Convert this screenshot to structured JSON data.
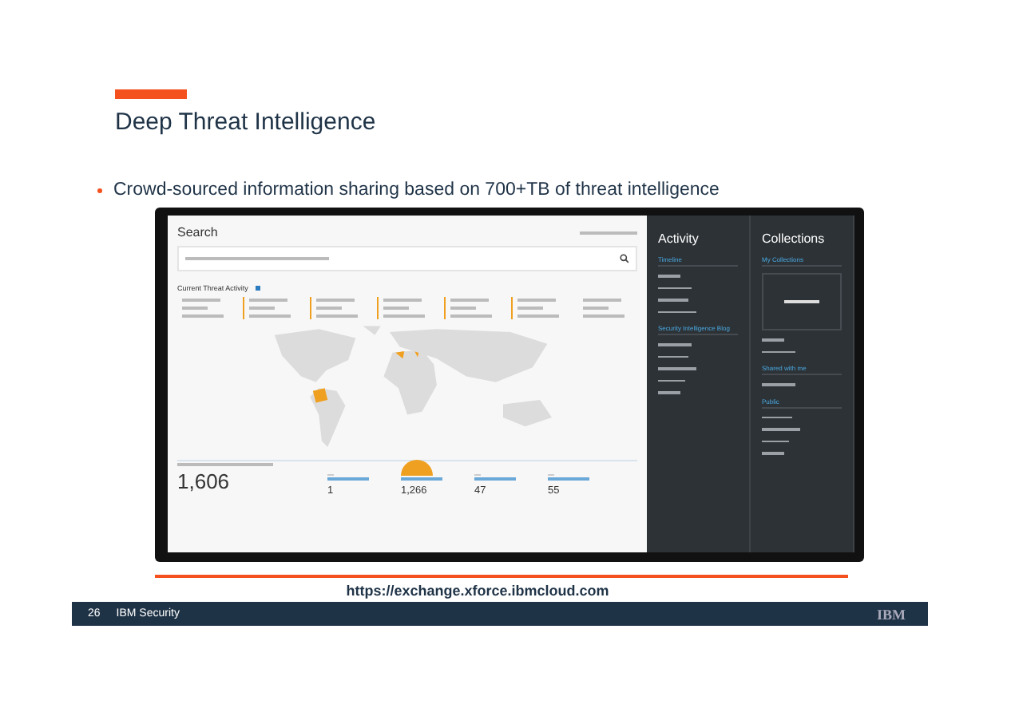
{
  "slide": {
    "title": "Deep Threat Intelligence",
    "bullet": "Crowd-sourced information sharing based on 700+TB of threat intelligence",
    "link": "https://exchange.xforce.ibmcloud.com"
  },
  "app": {
    "search_title": "Search",
    "activity_title": "Current Threat Activity",
    "total": "1,606",
    "stats": [
      {
        "value": "1",
        "bubble": false
      },
      {
        "value": "1,266",
        "bubble": true
      },
      {
        "value": "47",
        "bubble": false
      },
      {
        "value": "55",
        "bubble": false
      }
    ],
    "activity": {
      "title": "Activity",
      "sections": [
        {
          "heading": "Timeline"
        },
        {
          "heading": "Security Intelligence Blog"
        }
      ]
    },
    "collections": {
      "title": "Collections",
      "sections": [
        {
          "heading": "My Collections"
        },
        {
          "heading": "Shared with me"
        },
        {
          "heading": "Public"
        }
      ]
    }
  },
  "footer": {
    "page": "26",
    "label": "IBM Security",
    "logo": "IBM"
  }
}
